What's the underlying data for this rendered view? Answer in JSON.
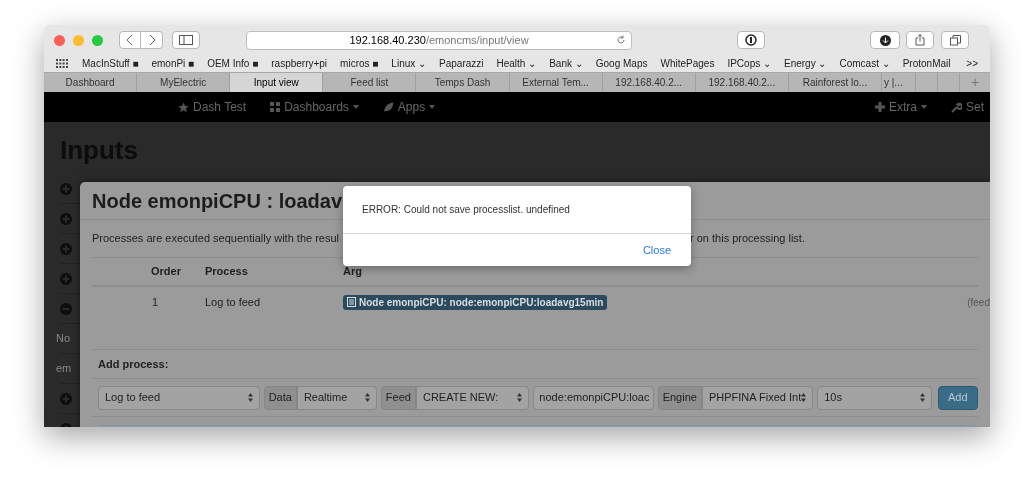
{
  "toolbar": {
    "url_host": "192.168.40.230",
    "url_path": "/emoncms/input/view"
  },
  "bookmarks": [
    "MacInStuff ■",
    "emonPi ■",
    "OEM Info ■",
    "raspberry+pi",
    "micros ■",
    "Linux ⌄",
    "Paparazzi",
    "Health ⌄",
    "Bank ⌄",
    "Goog Maps",
    "WhitePages",
    "IPCops ⌄",
    "Energy ⌄",
    "Comcast ⌄",
    "ProtonMail"
  ],
  "bookmarks_more": ">>",
  "tabs": [
    {
      "label": "Dashboard",
      "selected": false
    },
    {
      "label": "MyElectric",
      "selected": false
    },
    {
      "label": "Input view",
      "selected": true
    },
    {
      "label": "Feed list",
      "selected": false
    },
    {
      "label": "Temps Dash",
      "selected": false
    },
    {
      "label": "External Tem...",
      "selected": false
    },
    {
      "label": "192.168.40.2...",
      "selected": false
    },
    {
      "label": "192.168.40.2...",
      "selected": false
    },
    {
      "label": "Rainforest lo...",
      "selected": false
    },
    {
      "label": "y |...",
      "selected": false
    }
  ],
  "new_tab": "+",
  "navbar": [
    {
      "label": "Dash Test",
      "kind": "star",
      "dropdown": false
    },
    {
      "label": "Dashboards",
      "kind": "grid",
      "dropdown": true
    },
    {
      "label": "Apps",
      "kind": "leaf",
      "dropdown": true
    }
  ],
  "navbar_right": [
    {
      "label": "Extra",
      "kind": "plus",
      "dropdown": true
    },
    {
      "label": "Set",
      "kind": "wrench",
      "dropdown": false
    }
  ],
  "page": {
    "title": "Inputs",
    "list": [
      {
        "kind": "expand"
      },
      {
        "kind": "expand"
      },
      {
        "kind": "expand"
      },
      {
        "kind": "expand"
      },
      {
        "kind": "collapse"
      },
      {
        "kind": "text",
        "text": "No"
      },
      {
        "kind": "text",
        "text": "em"
      },
      {
        "kind": "expand"
      },
      {
        "kind": "expand"
      }
    ]
  },
  "modal": {
    "title": "Node emonpiCPU : loadav",
    "description_before": "Processes are executed sequentially with the resul",
    "description_after": "r on this processing list.",
    "columns": [
      "Order",
      "Process",
      "Arg"
    ],
    "rows": [
      {
        "order": "1",
        "process": "Log to feed",
        "arg": "Node emonpiCPU: node:emonpiCPU:loadavg15min",
        "extra": "(feed"
      }
    ],
    "add_label": "Add process:",
    "add_controls": [
      {
        "kind": "select",
        "value": "Log to feed"
      },
      {
        "kind": "addon",
        "text": "Data"
      },
      {
        "kind": "select",
        "value": "Realtime"
      },
      {
        "kind": "addon",
        "text": "Feed"
      },
      {
        "kind": "select",
        "value": "CREATE NEW:"
      },
      {
        "kind": "input",
        "value": "node:emonpiCPU:loac"
      },
      {
        "kind": "addon",
        "text": "Engine"
      },
      {
        "kind": "select",
        "value": "PHPFINA Fixed Int"
      },
      {
        "kind": "select",
        "value": "10s"
      },
      {
        "kind": "button",
        "text": "Add"
      }
    ]
  },
  "dialog": {
    "message": "ERROR: Could not save processlist. undefined",
    "button": "Close"
  }
}
